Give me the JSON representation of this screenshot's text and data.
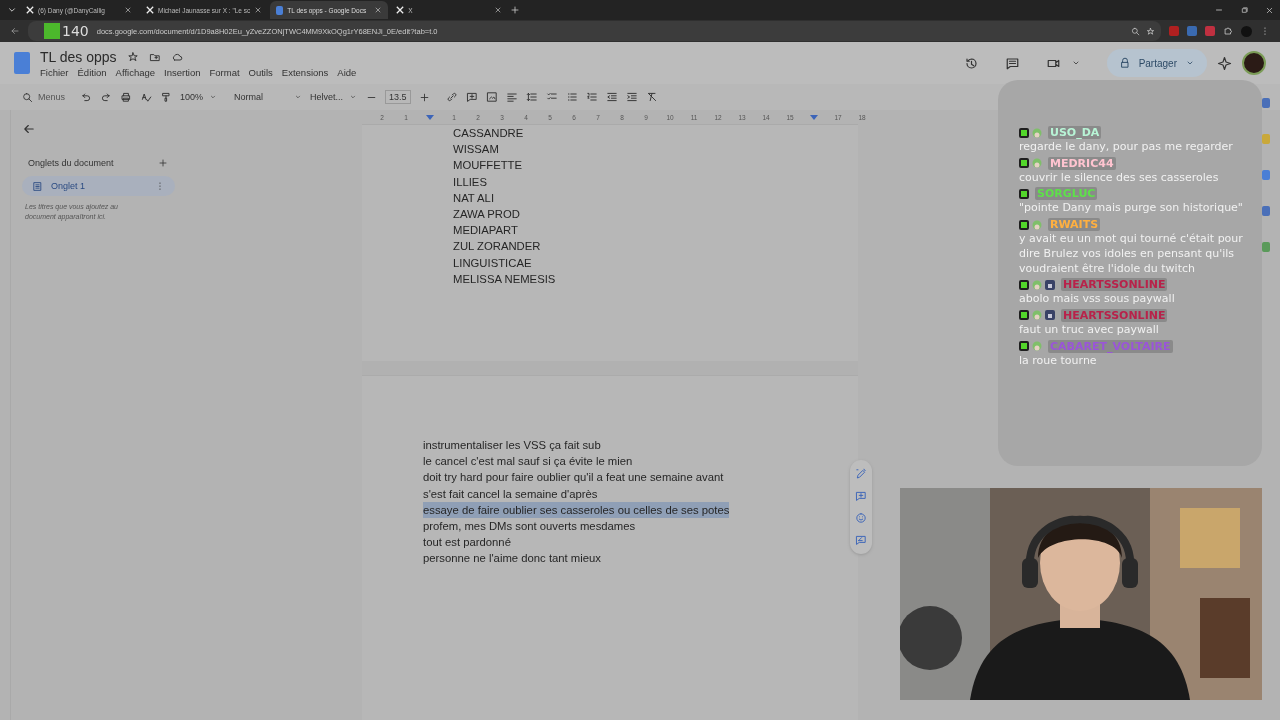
{
  "browser": {
    "tabs": [
      {
        "title": "(6) Dany (@DanyCallig",
        "selected": false
      },
      {
        "title": "Michael Jaunasse sur X : \"Le sc",
        "selected": false
      },
      {
        "title": "TL des opps - Google Docs",
        "selected": true
      },
      {
        "title": "X",
        "selected": false
      }
    ],
    "url": "docs.google.com/document/d/1D9a8H02Eu_yZveZZONjTWC4MM9XkOQg1rY68ENJi_0E/edit?tab=t.0",
    "overlay_logo": "140"
  },
  "doc": {
    "title": "TL des opps",
    "menus": [
      "Fichier",
      "Édition",
      "Affichage",
      "Insertion",
      "Format",
      "Outils",
      "Extensions",
      "Aide"
    ],
    "share": "Partager"
  },
  "toolbar": {
    "search": "Menus",
    "zoom": "100%",
    "style": "Normal",
    "font": "Helvet...",
    "size": "13.5"
  },
  "sidebar": {
    "heading": "Onglets du document",
    "tabs": [
      {
        "label": "Onglet 1",
        "selected": true
      }
    ],
    "hint": "Les titres que vous ajoutez au document apparaîtront ici."
  },
  "ruler": [
    {
      "kind": "number",
      "label": "2"
    },
    {
      "kind": "number",
      "label": "1"
    },
    {
      "kind": "marker"
    },
    {
      "kind": "number",
      "label": "1"
    },
    {
      "kind": "number",
      "label": "2"
    },
    {
      "kind": "number",
      "label": "3"
    },
    {
      "kind": "number",
      "label": "4"
    },
    {
      "kind": "number",
      "label": "5"
    },
    {
      "kind": "number",
      "label": "6"
    },
    {
      "kind": "number",
      "label": "7"
    },
    {
      "kind": "number",
      "label": "8"
    },
    {
      "kind": "number",
      "label": "9"
    },
    {
      "kind": "number",
      "label": "10"
    },
    {
      "kind": "number",
      "label": "11"
    },
    {
      "kind": "number",
      "label": "12"
    },
    {
      "kind": "number",
      "label": "13"
    },
    {
      "kind": "number",
      "label": "14"
    },
    {
      "kind": "number",
      "label": "15"
    },
    {
      "kind": "marker"
    },
    {
      "kind": "number",
      "label": "17"
    },
    {
      "kind": "number",
      "label": "18"
    }
  ],
  "page1": [
    "CASSANDRE",
    "WISSAM",
    "MOUFFETTE",
    "ILLIES",
    "NAT ALI",
    "ZAWA PROD",
    "MEDIAPART",
    "ZUL ZORANDER",
    "LINGUISTICAE",
    "MELISSA NEMESIS"
  ],
  "page2": [
    {
      "text": "instrumentaliser les VSS ça fait sub",
      "selected": false
    },
    {
      "text": "le cancel c'est mal sauf si ça évite le mien",
      "selected": false
    },
    {
      "text": "doit try hard pour faire oublier qu'il a feat une semaine avant",
      "selected": false
    },
    {
      "text": "s'est fait cancel la semaine d'après",
      "selected": false
    },
    {
      "text": "essaye de faire oublier ses casseroles ou celles de ses potes",
      "selected": true
    },
    {
      "text": "profem, mes DMs sont ouverts mesdames",
      "selected": false
    },
    {
      "text": "tout est pardonné",
      "selected": false
    },
    {
      "text": "personne ne l'aime donc tant mieux",
      "selected": false
    }
  ],
  "chat": [
    {
      "user": "USO_DA",
      "color": "#b8f5d6",
      "badges": [
        {
          "kind": "k"
        },
        {
          "kind": "emote"
        }
      ],
      "text": "regarde le dany, pour pas me regarder"
    },
    {
      "user": "MEDRIC44",
      "color": "#ffc4d0",
      "badges": [
        {
          "kind": "k"
        },
        {
          "kind": "emote"
        }
      ],
      "text": "couvrir le silence des ses casseroles"
    },
    {
      "user": "SORGLUC",
      "color": "#5ee04a",
      "badges": [
        {
          "kind": "k"
        }
      ],
      "text": "\"pointe Dany mais purge son historique\""
    },
    {
      "user": "RWAITS",
      "color": "#ffb040",
      "badges": [
        {
          "kind": "k"
        },
        {
          "kind": "emote"
        }
      ],
      "text": "y avait eu un mot qui tourné c'était pour dire Brulez vos idoles en pensant qu'ils voudraient être l'idole du twitch"
    },
    {
      "user": "HEARTSSONLINE",
      "color": "#b8224a",
      "badges": [
        {
          "kind": "k"
        },
        {
          "kind": "emote"
        },
        {
          "kind": "lock"
        }
      ],
      "text": "abolo mais vss sous paywall"
    },
    {
      "user": "HEARTSSONLINE",
      "color": "#b8224a",
      "badges": [
        {
          "kind": "k"
        },
        {
          "kind": "emote"
        },
        {
          "kind": "lock"
        }
      ],
      "text": "faut un truc avec paywall"
    },
    {
      "user": "CABARET_VOLTAIRE",
      "color": "#9a55d8",
      "badges": [
        {
          "kind": "k"
        },
        {
          "kind": "emote"
        }
      ],
      "text": "la roue tourne"
    }
  ]
}
